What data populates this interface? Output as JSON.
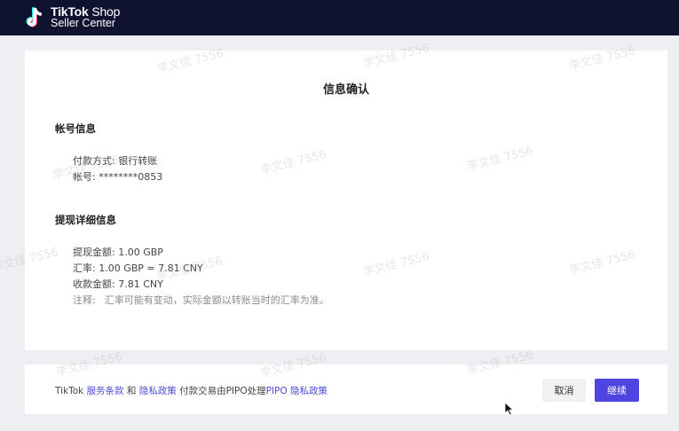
{
  "brand": {
    "line1_bold": "TikTok",
    "line1_rest": " Shop",
    "line2": "Seller Center"
  },
  "card": {
    "title": "信息确认",
    "account_section": {
      "title": "帐号信息",
      "payment_method": "付款方式: 银行转账",
      "account_number": "帐号: ********0853"
    },
    "withdraw_section": {
      "title": "提现详细信息",
      "amount": "提现金额: 1.00 GBP",
      "rate": "汇率: 1.00 GBP = 7.81 CNY",
      "received": "收款金额: 7.81 CNY",
      "note_label": "注释:",
      "note_text": "汇率可能有变动，实际金额以转账当时的汇率为准。"
    }
  },
  "footer": {
    "prefix": "TikTok ",
    "terms_link": "服务条款",
    "and": " 和 ",
    "privacy_link": "隐私政策",
    "middle": " 付款交易由PIPO处理",
    "pipo_link": "PIPO 隐私政策",
    "cancel_label": "取消",
    "continue_label": "继续"
  },
  "watermark_text": "李文佳 7556",
  "colors": {
    "topbar": "#0f1330",
    "accent": "#4e44e0",
    "link": "#4d4ad8",
    "background": "#eeeff2"
  },
  "icons": {
    "logo": "tiktok-logo-icon",
    "cursor": "mouse-cursor-icon"
  }
}
